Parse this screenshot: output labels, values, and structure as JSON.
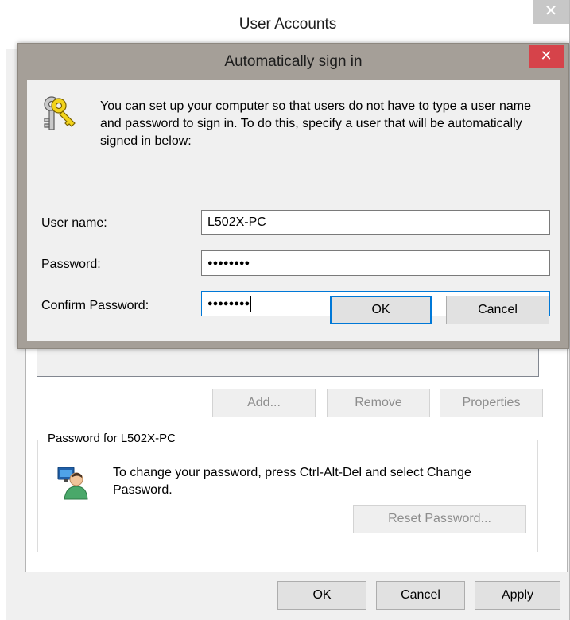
{
  "outer": {
    "title": "User Accounts",
    "close_glyph": "✕",
    "buttons": {
      "add": "Add...",
      "remove": "Remove",
      "properties": "Properties"
    },
    "password_group": {
      "legend": "Password for L502X-PC",
      "text": "To change your password, press Ctrl-Alt-Del and select Change Password.",
      "reset": "Reset Password..."
    },
    "footer": {
      "ok": "OK",
      "cancel": "Cancel",
      "apply": "Apply"
    }
  },
  "dialog": {
    "title": "Automatically sign in",
    "close_glyph": "✕",
    "intro": "You can set up your computer so that users do not have to type a user name and password to sign in. To do this, specify a user that will be automatically signed in below:",
    "fields": {
      "username": {
        "label": "User name:",
        "value": "L502X-PC"
      },
      "password": {
        "label": "Password:",
        "value": "●●●●●●●●"
      },
      "confirm": {
        "label": "Confirm Password:",
        "value": "●●●●●●●●"
      }
    },
    "buttons": {
      "ok": "OK",
      "cancel": "Cancel"
    }
  },
  "colors": {
    "dialog_frame": "#a59f98",
    "close_red": "#d6434a",
    "focus_blue": "#0078d7"
  }
}
